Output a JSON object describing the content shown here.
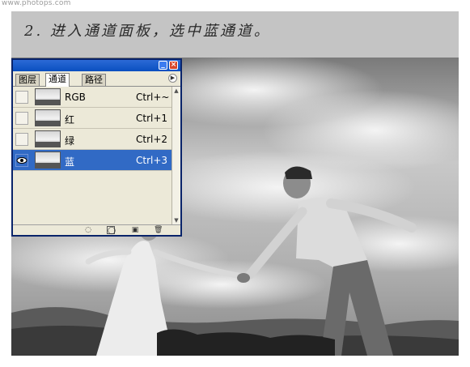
{
  "watermark": "www.photops.com",
  "step_caption": "2. 进入通道面板，选中蓝通道。",
  "palette": {
    "tabs": [
      {
        "label": "图层"
      },
      {
        "label": "通道"
      },
      {
        "label": "路径"
      }
    ],
    "active_tab": "通道",
    "channels": [
      {
        "name": "RGB",
        "shortcut": "Ctrl+~",
        "visible": false,
        "selected": false
      },
      {
        "name": "红",
        "shortcut": "Ctrl+1",
        "visible": false,
        "selected": false
      },
      {
        "name": "绿",
        "shortcut": "Ctrl+2",
        "visible": false,
        "selected": false
      },
      {
        "name": "蓝",
        "shortcut": "Ctrl+3",
        "visible": true,
        "selected": true
      }
    ],
    "bottom_icons": [
      "load-selection-icon",
      "save-selection-icon",
      "new-channel-icon",
      "trash-icon"
    ],
    "colors": {
      "selection": "#316ac5",
      "titlebar": "#0a4fc0",
      "panel_bg": "#ece9d8"
    }
  }
}
